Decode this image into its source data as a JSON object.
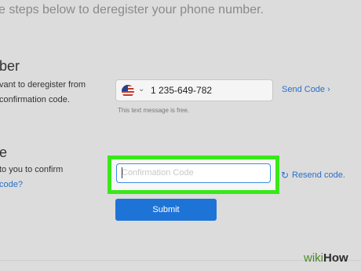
{
  "header": {
    "instruction": "e steps below to deregister your phone number."
  },
  "phone_section": {
    "heading": "ber",
    "desc_line1": "vant to deregister from",
    "desc_line2": "confirmation code.",
    "country_flag_icon": "us-flag-icon",
    "phone_number": "1 235-649-782",
    "send_code_label": "Send Code ›",
    "note": "This text message is free."
  },
  "code_section": {
    "heading": "e",
    "desc_line1": "to you to confirm",
    "desc_line2": "code?",
    "input_placeholder": "Confirmation Code",
    "resend_label": "Resend code.",
    "submit_label": "Submit"
  },
  "watermark": {
    "wiki": "wiki",
    "how": "How"
  },
  "colors": {
    "accent": "#1e74d6",
    "link": "#2a6fc9",
    "highlight": "#39e81a"
  }
}
